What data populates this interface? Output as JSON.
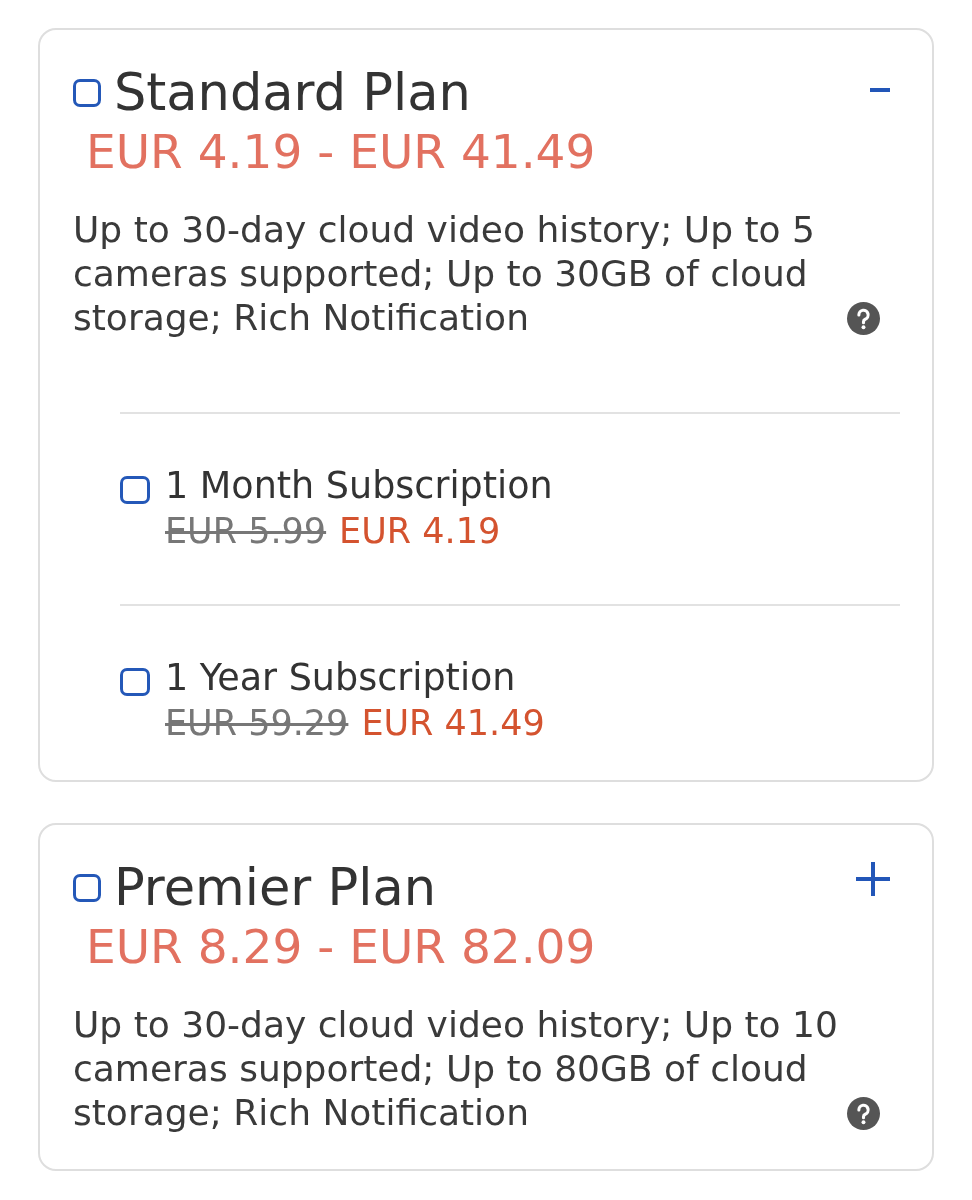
{
  "plans": [
    {
      "name": "Standard Plan",
      "checked": false,
      "expanded": true,
      "price_range": "EUR 4.19 - EUR 41.49",
      "description": "Up to 30-day cloud video history; Up to 5 cameras supported; Up to 30GB of cloud storage; Rich Notification",
      "options": [
        {
          "name": "1 Month Subscription",
          "checked": false,
          "original_price": "EUR 5.99",
          "price": "EUR 4.19"
        },
        {
          "name": "1 Year Subscription",
          "checked": false,
          "original_price": "EUR 59.29",
          "price": "EUR 41.49"
        }
      ]
    },
    {
      "name": "Premier Plan",
      "checked": false,
      "expanded": false,
      "price_range": "EUR 8.29 - EUR 82.09",
      "description": "Up to 30-day cloud video history; Up to 10 cameras supported; Up to 80GB of cloud storage; Rich Notification"
    }
  ]
}
